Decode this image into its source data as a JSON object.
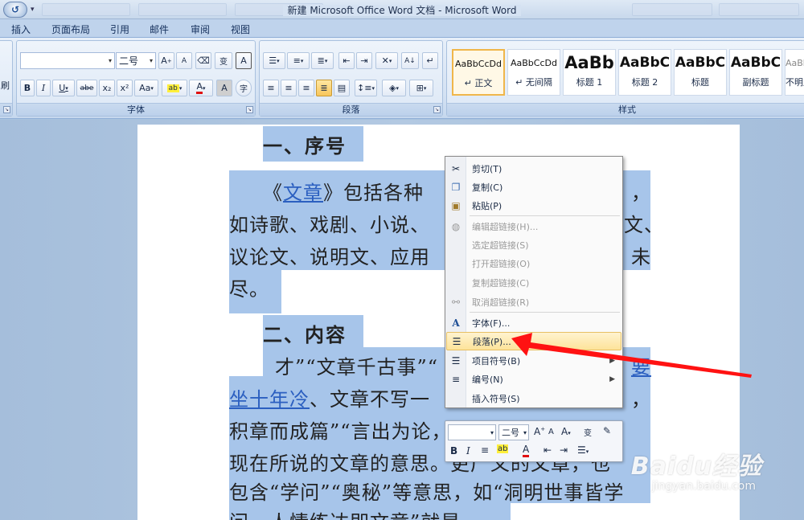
{
  "window": {
    "title": "新建 Microsoft Office Word 文档 - Microsoft Word",
    "qat_undo": "↺"
  },
  "ribbon_tabs": [
    "插入",
    "页面布局",
    "引用",
    "邮件",
    "审阅",
    "视图"
  ],
  "ribbon": {
    "left_stub_label": "刷",
    "font_group": {
      "label": "字体",
      "font_name": "",
      "font_size": "二号",
      "grow": "A",
      "shrink": "A",
      "phonetic": "变",
      "clear_format": "A",
      "bold": "B",
      "italic": "I",
      "underline": "U",
      "strike": "abe",
      "subscript": "x₂",
      "superscript": "x²",
      "change_case": "Aa",
      "char_border": "A",
      "enclose": "字"
    },
    "paragraph_group": {
      "label": "段落"
    },
    "styles_group": {
      "label": "样式",
      "styles": [
        {
          "sample": "AaBbCcDd",
          "name": "正文"
        },
        {
          "sample": "AaBbCcDd",
          "name": "无间隔"
        },
        {
          "sample": "AaBb",
          "name": "标题 1"
        },
        {
          "sample": "AaBbC",
          "name": "标题 2"
        },
        {
          "sample": "AaBbC",
          "name": "标题"
        },
        {
          "sample": "AaBbC",
          "name": "副标题"
        },
        {
          "sample": "AaBbC",
          "name": "不明显"
        }
      ]
    }
  },
  "document": {
    "heading1": "一、序号",
    "p1_prefix": "《",
    "p1_link": "文章",
    "p1_rest": "》包括各种",
    "p1_end": "，",
    "line2": "如诗歌、戏剧、小说、",
    "line2_end": "文、",
    "line3": "议论文、说明文、应用",
    "line3_end": "未",
    "line4": "尽。",
    "heading2": "二、内容",
    "p2_line1": "才”“文章千古事”“",
    "p2_line1_link": "要",
    "p2_line2_link": "坐十年冷",
    "p2_line2_rest": "、文章不写一",
    "p2_line2_end": "，",
    "p2_line3": "积章而成篇”“言出为论，下笔成章”等，都是",
    "p2_line4": "现在所说的文章的意思。更广义的文章，也",
    "p2_line5": "包含“学问”“奥秘”等意思，如“洞明世事皆学",
    "p2_line6": "问，人情练达即文章”就是"
  },
  "context_menu": {
    "items": [
      {
        "label": "剪切(T)",
        "icon": "scissors-icon",
        "enabled": true
      },
      {
        "label": "复制(C)",
        "icon": "copy-icon",
        "enabled": true
      },
      {
        "label": "粘贴(P)",
        "icon": "paste-icon",
        "enabled": true
      },
      {
        "label": "编辑超链接(H)...",
        "icon": "hyperlink-icon",
        "enabled": false
      },
      {
        "label": "选定超链接(S)",
        "icon": "",
        "enabled": false
      },
      {
        "label": "打开超链接(O)",
        "icon": "",
        "enabled": false
      },
      {
        "label": "复制超链接(C)",
        "icon": "",
        "enabled": false
      },
      {
        "label": "取消超链接(R)",
        "icon": "unlink-icon",
        "enabled": false
      },
      {
        "label": "字体(F)...",
        "icon": "font-icon",
        "enabled": true
      },
      {
        "label": "段落(P)...",
        "icon": "paragraph-icon",
        "enabled": true,
        "highlighted": true
      },
      {
        "label": "项目符号(B)",
        "icon": "bullets-icon",
        "enabled": true,
        "submenu": true
      },
      {
        "label": "编号(N)",
        "icon": "numbering-icon",
        "enabled": true,
        "submenu": true
      },
      {
        "label": "插入符号(S)",
        "icon": "",
        "enabled": true
      }
    ]
  },
  "mini_toolbar": {
    "font_name": "",
    "font_size": "二号",
    "bold": "B",
    "italic": "I"
  },
  "watermark": {
    "logo": "Baidu经验",
    "url": "jingyan.baidu.com"
  },
  "colors": {
    "selection": "#a7c5ea",
    "arrow": "#ff1010",
    "menu_highlight": "#fde39a"
  }
}
